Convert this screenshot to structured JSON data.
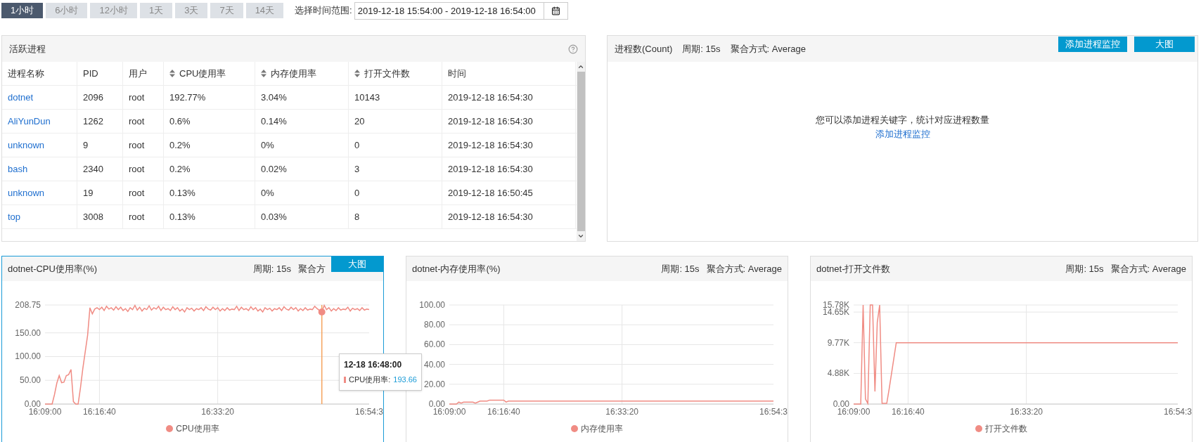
{
  "time_range": {
    "presets": [
      {
        "label": "1小时",
        "selected": true
      },
      {
        "label": "6小时",
        "selected": false
      },
      {
        "label": "12小时",
        "selected": false
      },
      {
        "label": "1天",
        "selected": false
      },
      {
        "label": "3天",
        "selected": false
      },
      {
        "label": "7天",
        "selected": false
      },
      {
        "label": "14天",
        "selected": false
      }
    ],
    "label": "选择时间范围:",
    "value": "2019-12-18 15:54:00 - 2019-12-18 16:54:00"
  },
  "process_table": {
    "title": "活跃进程",
    "columns": [
      {
        "label": "进程名称",
        "sortable": false
      },
      {
        "label": "PID",
        "sortable": false
      },
      {
        "label": "用户",
        "sortable": false
      },
      {
        "label": "CPU使用率",
        "sortable": true
      },
      {
        "label": "内存使用率",
        "sortable": true
      },
      {
        "label": "打开文件数",
        "sortable": true
      },
      {
        "label": "时间",
        "sortable": false
      }
    ],
    "rows": [
      [
        "dotnet",
        "2096",
        "root",
        "192.77%",
        "3.04%",
        "10143",
        "2019-12-18 16:54:30"
      ],
      [
        "AliYunDun",
        "1262",
        "root",
        "0.6%",
        "0.14%",
        "20",
        "2019-12-18 16:54:30"
      ],
      [
        "unknown",
        "9",
        "root",
        "0.2%",
        "0%",
        "0",
        "2019-12-18 16:54:30"
      ],
      [
        "bash",
        "2340",
        "root",
        "0.2%",
        "0.02%",
        "3",
        "2019-12-18 16:54:30"
      ],
      [
        "unknown",
        "19",
        "root",
        "0.13%",
        "0%",
        "0",
        "2019-12-18 16:50:45"
      ],
      [
        "top",
        "3008",
        "root",
        "0.13%",
        "0.03%",
        "8",
        "2019-12-18 16:54:30"
      ]
    ]
  },
  "process_count": {
    "title": "进程数(Count)",
    "meta": [
      "周期: 15s",
      "聚合方式: Average"
    ],
    "buttons": [
      "添加进程监控",
      "大图"
    ],
    "empty_message": "您可以添加进程关键字，统计对应进程数量",
    "empty_link": "添加进程监控"
  },
  "charts": [
    {
      "selected": true,
      "meta": [
        "周期: 15s",
        "聚合方"
      ],
      "button": "大图",
      "tooltip": {
        "title": "12-18 16:48:00",
        "label": "CPU使用率:",
        "value": "193.66"
      },
      "chart_data": {
        "type": "line",
        "title": "dotnet-CPU使用率(%)",
        "categories": [
          "16:09:00",
          null,
          null,
          null,
          null,
          null,
          null,
          null,
          null,
          null,
          null,
          null,
          null,
          null,
          null,
          null,
          null,
          null,
          null,
          null,
          null,
          null,
          null,
          "16:16:40",
          null,
          null,
          null,
          null,
          null,
          null,
          null,
          null,
          null,
          null,
          null,
          null,
          null,
          null,
          null,
          null,
          null,
          null,
          null,
          null,
          null,
          null,
          null,
          null,
          null,
          null,
          null,
          null,
          null,
          null,
          null,
          null,
          null,
          null,
          null,
          null,
          null,
          null,
          null,
          null,
          null,
          null,
          null,
          null,
          null,
          null,
          null,
          null,
          null,
          "16:33:20",
          null,
          null,
          null,
          null,
          null,
          null,
          null,
          null,
          null,
          null,
          null,
          null,
          null,
          null,
          null,
          null,
          null,
          null,
          null,
          null,
          null,
          null,
          null,
          null,
          null,
          null,
          null,
          null,
          null,
          null,
          null,
          null,
          null,
          null,
          null,
          null,
          null,
          null,
          null,
          null,
          null,
          null,
          null,
          null,
          null,
          null,
          null,
          null,
          null,
          null,
          null,
          null,
          null,
          null,
          null,
          null,
          null,
          null,
          null,
          null,
          null,
          null,
          null,
          "16:54:3"
        ],
        "series": [
          {
            "name": "CPU使用率",
            "color": "#f08c84",
            "values": [
              0,
              0,
              0,
              0,
              20,
              44,
              60,
              45,
              46,
              60,
              62,
              73,
              5,
              0,
              0,
              35,
              75,
              110,
              145,
              203,
              190,
              200,
              203,
              199,
              204,
              197,
              206,
              200,
              203,
              198,
              205,
              199,
              204,
              197,
              201,
              195,
              203,
              199,
              208,
              198,
              204,
              196,
              202,
              199,
              207,
              198,
              203,
              200,
              206,
              197,
              204,
              199,
              201,
              197,
              205,
              199,
              203,
              196,
              200,
              194,
              203,
              199,
              202,
              196,
              201,
              199,
              203,
              197,
              205,
              200,
              198,
              204,
              199,
              203,
              196,
              201,
              197,
              203,
              198,
              200,
              199,
              206,
              197,
              204,
              199,
              201,
              197,
              205,
              199,
              203,
              196,
              200,
              194,
              203,
              199,
              202,
              196,
              201,
              199,
              203,
              197,
              205,
              200,
              198,
              204,
              199,
              203,
              196,
              201,
              197,
              203,
              198,
              200,
              199,
              206,
              201,
              197,
              194,
              208,
              199,
              203,
              196,
              201,
              197,
              203,
              198,
              200,
              199,
              204,
              196,
              202,
              199,
              201,
              197,
              203,
              198,
              200,
              199
            ]
          }
        ],
        "ylim": [
          0,
          208.75
        ],
        "yticks": [
          {
            "value": 0,
            "label": "0.00"
          },
          {
            "value": 50,
            "label": "50.00"
          },
          {
            "value": 100,
            "label": "100.00"
          },
          {
            "value": 150,
            "label": "150.00"
          },
          {
            "value": 208.75,
            "label": "208.75"
          }
        ],
        "grid": true
      }
    },
    {
      "selected": false,
      "meta": [
        "周期: 15s",
        "聚合方式: Average"
      ],
      "chart_data": {
        "type": "line",
        "title": "dotnet-内存使用率(%)",
        "categories": [
          "16:09:00",
          null,
          null,
          null,
          null,
          null,
          null,
          null,
          null,
          null,
          null,
          null,
          null,
          null,
          null,
          null,
          null,
          null,
          null,
          null,
          null,
          null,
          null,
          "16:16:40",
          null,
          null,
          null,
          null,
          null,
          null,
          null,
          null,
          null,
          null,
          null,
          null,
          null,
          null,
          null,
          null,
          null,
          null,
          null,
          null,
          null,
          null,
          null,
          null,
          null,
          null,
          null,
          null,
          null,
          null,
          null,
          null,
          null,
          null,
          null,
          null,
          null,
          null,
          null,
          null,
          null,
          null,
          null,
          null,
          null,
          null,
          null,
          null,
          null,
          "16:33:20",
          null,
          null,
          null,
          null,
          null,
          null,
          null,
          null,
          null,
          null,
          null,
          null,
          null,
          null,
          null,
          null,
          null,
          null,
          null,
          null,
          null,
          null,
          null,
          null,
          null,
          null,
          null,
          null,
          null,
          null,
          null,
          null,
          null,
          null,
          null,
          null,
          null,
          null,
          null,
          null,
          null,
          null,
          null,
          null,
          null,
          null,
          null,
          null,
          null,
          null,
          null,
          null,
          null,
          null,
          null,
          null,
          null,
          null,
          null,
          null,
          null,
          null,
          null,
          "16:54:3"
        ],
        "series": [
          {
            "name": "内存使用率",
            "color": "#f08c84",
            "values": [
              0,
              0,
              0,
              0,
              2,
              1,
              2,
              2,
              2,
              2,
              2,
              1,
              2,
              3,
              3,
              3,
              3,
              4,
              4,
              4,
              4,
              4,
              4,
              4,
              2,
              3,
              3,
              3,
              3,
              3,
              3,
              3,
              3,
              3,
              3,
              3,
              3,
              3,
              3,
              3,
              3,
              3,
              3,
              3,
              3,
              3,
              3,
              3,
              3,
              3,
              3,
              3,
              3,
              3,
              3,
              3,
              3,
              3,
              3,
              3,
              3,
              3,
              3,
              3,
              3,
              3,
              3,
              3,
              3,
              3,
              3,
              3,
              3,
              3,
              3,
              3,
              3,
              3,
              3,
              3,
              3,
              3,
              3,
              3,
              3,
              3,
              3,
              3,
              3,
              3,
              3,
              3,
              3,
              3,
              3,
              3,
              3,
              3,
              3,
              3,
              3,
              3,
              3,
              3,
              3,
              3,
              3,
              3,
              3,
              3,
              3,
              3,
              3,
              3,
              3,
              3,
              3,
              3,
              3,
              3,
              3,
              3,
              3,
              3,
              3,
              3,
              3,
              3,
              3,
              3,
              3,
              3,
              3,
              3,
              3,
              3,
              3,
              3
            ]
          }
        ],
        "ylim": [
          0,
          100
        ],
        "yticks": [
          {
            "value": 0,
            "label": "0.00"
          },
          {
            "value": 20,
            "label": "20.00"
          },
          {
            "value": 40,
            "label": "40.00"
          },
          {
            "value": 60,
            "label": "60.00"
          },
          {
            "value": 80,
            "label": "80.00"
          },
          {
            "value": 100,
            "label": "100.00"
          }
        ],
        "grid": true
      }
    },
    {
      "selected": false,
      "meta": [
        "周期: 15s",
        "聚合方式: Average"
      ],
      "chart_data": {
        "type": "line",
        "title": "dotnet-打开文件数",
        "categories": [
          "16:09:00",
          null,
          null,
          null,
          null,
          null,
          null,
          null,
          null,
          null,
          null,
          null,
          null,
          null,
          null,
          null,
          null,
          null,
          null,
          null,
          null,
          null,
          null,
          "16:16:40",
          null,
          null,
          null,
          null,
          null,
          null,
          null,
          null,
          null,
          null,
          null,
          null,
          null,
          null,
          null,
          null,
          null,
          null,
          null,
          null,
          null,
          null,
          null,
          null,
          null,
          null,
          null,
          null,
          null,
          null,
          null,
          null,
          null,
          null,
          null,
          null,
          null,
          null,
          null,
          null,
          null,
          null,
          null,
          null,
          null,
          null,
          null,
          null,
          null,
          "16:33:20",
          null,
          null,
          null,
          null,
          null,
          null,
          null,
          null,
          null,
          null,
          null,
          null,
          null,
          null,
          null,
          null,
          null,
          null,
          null,
          null,
          null,
          null,
          null,
          null,
          null,
          null,
          null,
          null,
          null,
          null,
          null,
          null,
          null,
          null,
          null,
          null,
          null,
          null,
          null,
          null,
          null,
          null,
          null,
          null,
          null,
          null,
          null,
          null,
          null,
          null,
          null,
          null,
          null,
          null,
          null,
          null,
          null,
          null,
          null,
          null,
          null,
          null,
          null,
          "16:54:3"
        ],
        "series": [
          {
            "name": "打开文件数",
            "color": "#f08c84",
            "values": [
              0,
              0,
              0,
              0,
              15780,
              800,
              100,
              15780,
              15780,
              2000,
              13000,
              15780,
              100,
              100,
              100,
              2400,
              4800,
              7300,
              9770,
              9770,
              9770,
              9770,
              9770,
              9770,
              9770,
              9770,
              9770,
              9770,
              9770,
              9770,
              9770,
              9770,
              9770,
              9770,
              9770,
              9770,
              9770,
              9770,
              9770,
              9770,
              9770,
              9770,
              9770,
              9770,
              9770,
              9770,
              9770,
              9770,
              9770,
              9770,
              9770,
              9770,
              9770,
              9770,
              9770,
              9770,
              9770,
              9770,
              9770,
              9770,
              9770,
              9770,
              9770,
              9770,
              9770,
              9770,
              9770,
              9770,
              9770,
              9770,
              9770,
              9770,
              9770,
              9770,
              9770,
              9770,
              9770,
              9770,
              9770,
              9770,
              9770,
              9770,
              9770,
              9770,
              9770,
              9770,
              9770,
              9770,
              9770,
              9770,
              9770,
              9770,
              9770,
              9770,
              9770,
              9770,
              9770,
              9770,
              9770,
              9770,
              9770,
              9770,
              9770,
              9770,
              9770,
              9770,
              9770,
              9770,
              9770,
              9770,
              9770,
              9770,
              9770,
              9770,
              9770,
              9770,
              9770,
              9770,
              9770,
              9770,
              9770,
              9770,
              9770,
              9770,
              9770,
              9770,
              9770,
              9770,
              9770,
              9770,
              9770,
              9770,
              9770,
              9770,
              9770,
              9770,
              9770,
              9770
            ]
          }
        ],
        "ylim": [
          0,
          15780
        ],
        "yticks": [
          {
            "value": 0,
            "label": "0.00"
          },
          {
            "value": 4880,
            "label": "4.88K"
          },
          {
            "value": 9770,
            "label": "9.77K"
          },
          {
            "value": 14650,
            "label": "14.65K"
          },
          {
            "value": 15780,
            "label": "15.78K"
          }
        ],
        "grid": true
      }
    }
  ]
}
